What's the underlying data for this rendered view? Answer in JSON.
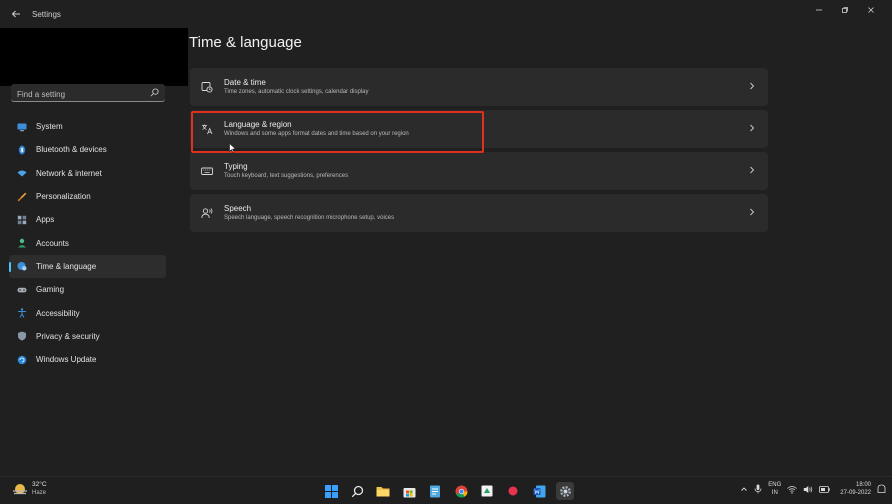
{
  "window": {
    "title": "Settings",
    "controls": [
      "minimize",
      "restore",
      "close"
    ]
  },
  "search": {
    "placeholder": "Find a setting"
  },
  "sidebar": {
    "items": [
      {
        "label": "System",
        "icon": "monitor-icon"
      },
      {
        "label": "Bluetooth & devices",
        "icon": "bluetooth-icon"
      },
      {
        "label": "Network & internet",
        "icon": "wifi-icon"
      },
      {
        "label": "Personalization",
        "icon": "brush-icon"
      },
      {
        "label": "Apps",
        "icon": "apps-icon"
      },
      {
        "label": "Accounts",
        "icon": "person-icon"
      },
      {
        "label": "Time & language",
        "icon": "globe-clock-icon",
        "active": true
      },
      {
        "label": "Gaming",
        "icon": "gamepad-icon"
      },
      {
        "label": "Accessibility",
        "icon": "accessibility-icon"
      },
      {
        "label": "Privacy & security",
        "icon": "shield-icon"
      },
      {
        "label": "Windows Update",
        "icon": "update-icon"
      }
    ]
  },
  "main": {
    "title": "Time & language",
    "cards": [
      {
        "title": "Date & time",
        "subtitle": "Time zones, automatic clock settings, calendar display",
        "icon": "clock-icon"
      },
      {
        "title": "Language & region",
        "subtitle": "Windows and some apps format dates and time based on your region",
        "icon": "language-icon",
        "highlighted": true
      },
      {
        "title": "Typing",
        "subtitle": "Touch keyboard, text suggestions, preferences",
        "icon": "keyboard-icon"
      },
      {
        "title": "Speech",
        "subtitle": "Speech language, speech recognition microphone setup, voices",
        "icon": "speech-icon"
      }
    ]
  },
  "colors": {
    "accent": "#4cc2ff",
    "highlight": "#e0301e",
    "background": "#202020",
    "card": "#2b2b2b"
  },
  "taskbar": {
    "weather": {
      "temp": "32°C",
      "condition": "Haze"
    },
    "apps": [
      "start-icon",
      "search-icon",
      "file-explorer-icon",
      "store-icon",
      "notepad-icon",
      "chrome-icon",
      "app-green-icon",
      "app-red-icon",
      "word-icon",
      "settings-icon"
    ],
    "lang_top": "ENG",
    "lang_bottom": "IN",
    "time": "18:00",
    "date": "27-09-2022"
  }
}
